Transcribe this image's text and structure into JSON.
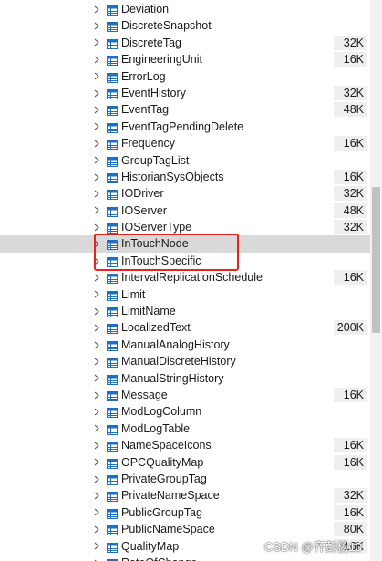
{
  "tables": [
    {
      "name": "Deviation",
      "size": ""
    },
    {
      "name": "DiscreteSnapshot",
      "size": ""
    },
    {
      "name": "DiscreteTag",
      "size": "32K"
    },
    {
      "name": "EngineeringUnit",
      "size": "16K"
    },
    {
      "name": "ErrorLog",
      "size": ""
    },
    {
      "name": "EventHistory",
      "size": "32K"
    },
    {
      "name": "EventTag",
      "size": "48K"
    },
    {
      "name": "EventTagPendingDelete",
      "size": ""
    },
    {
      "name": "Frequency",
      "size": "16K"
    },
    {
      "name": "GroupTagList",
      "size": ""
    },
    {
      "name": "HistorianSysObjects",
      "size": "16K"
    },
    {
      "name": "IODriver",
      "size": "32K"
    },
    {
      "name": "IOServer",
      "size": "48K"
    },
    {
      "name": "IOServerType",
      "size": "32K"
    },
    {
      "name": "InTouchNode",
      "size": "",
      "selected": true
    },
    {
      "name": "InTouchSpecific",
      "size": ""
    },
    {
      "name": "IntervalReplicationSchedule",
      "size": "16K"
    },
    {
      "name": "Limit",
      "size": ""
    },
    {
      "name": "LimitName",
      "size": ""
    },
    {
      "name": "LocalizedText",
      "size": "200K"
    },
    {
      "name": "ManualAnalogHistory",
      "size": ""
    },
    {
      "name": "ManualDiscreteHistory",
      "size": ""
    },
    {
      "name": "ManualStringHistory",
      "size": ""
    },
    {
      "name": "Message",
      "size": "16K"
    },
    {
      "name": "ModLogColumn",
      "size": ""
    },
    {
      "name": "ModLogTable",
      "size": ""
    },
    {
      "name": "NameSpaceIcons",
      "size": "16K"
    },
    {
      "name": "OPCQualityMap",
      "size": "16K"
    },
    {
      "name": "PrivateGroupTag",
      "size": ""
    },
    {
      "name": "PrivateNameSpace",
      "size": "32K"
    },
    {
      "name": "PublicGroupTag",
      "size": "16K"
    },
    {
      "name": "PublicNameSpace",
      "size": "80K"
    },
    {
      "name": "QualityMap",
      "size": "16K"
    },
    {
      "name": "RateOfChange",
      "size": ""
    }
  ],
  "highlight": {
    "first_row": 14,
    "last_row": 15
  },
  "scroll_position": 0.45,
  "watermark": "CSDN @齐彭杨10",
  "colors": {
    "selection": "#d9d9d9",
    "highlight_border": "#e8231e",
    "table_icon": "#1f6fbf",
    "size_badge": "#efefef"
  }
}
